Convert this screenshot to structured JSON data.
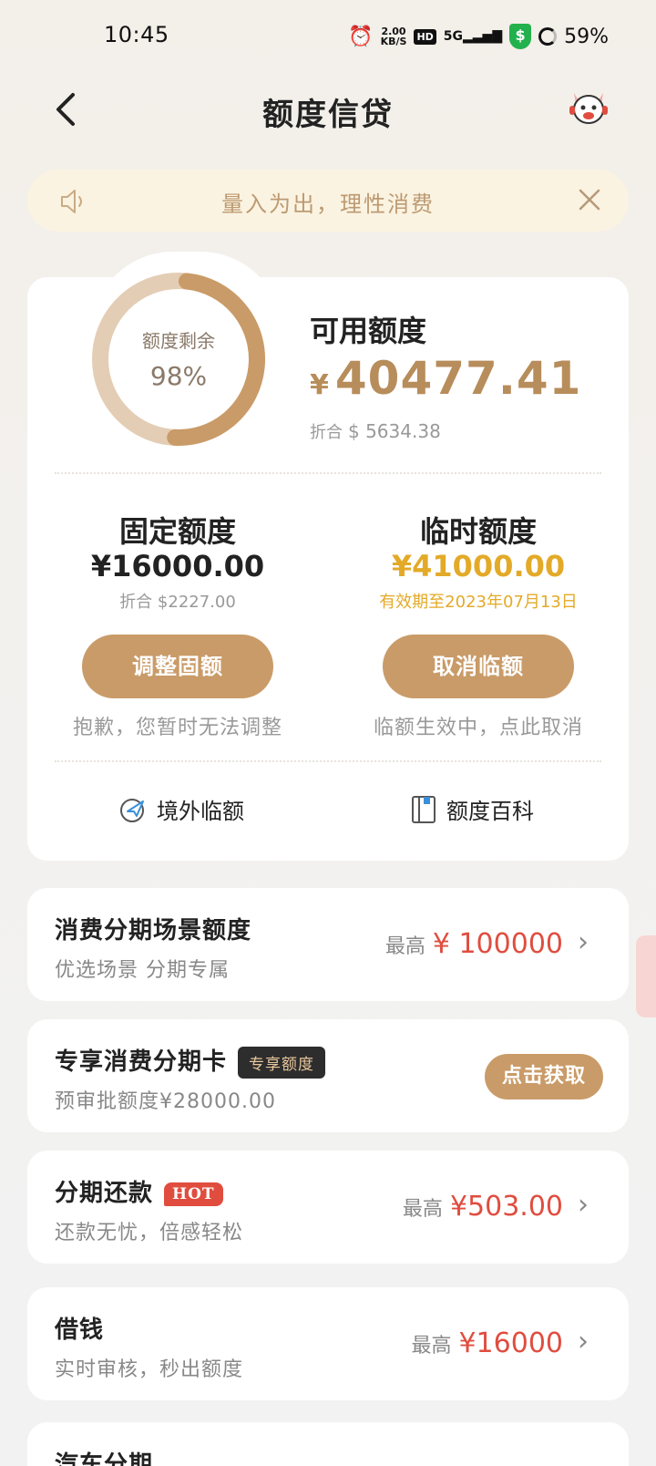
{
  "status": {
    "time": "10:45",
    "net_speed": "2.00",
    "net_unit": "KB/S",
    "hd": "HD",
    "signal": "5G",
    "battery": "59%"
  },
  "nav": {
    "title": "额度信贷",
    "back_icon": "chevron-left-icon",
    "service_icon": "mascot-icon"
  },
  "notice": {
    "text": "量入为出，理性消费"
  },
  "credit": {
    "remaining_label": "额度剩余",
    "remaining_percent": "98%",
    "remaining_fraction": 0.98,
    "available_title": "可用额度",
    "currency_symbol": "¥",
    "available_amount": "40477.41",
    "usd_label": "折合",
    "usd_amount": "$ 5634.38",
    "fixed": {
      "title": "固定额度",
      "amount": "¥16000.00",
      "sub": "折合 $2227.00",
      "button": "调整固额",
      "note": "抱歉，您暂时无法调整"
    },
    "temp": {
      "title": "临时额度",
      "amount": "¥41000.00",
      "sub": "有效期至2023年07月13日",
      "button": "取消临额",
      "note": "临额生效中，点此取消"
    },
    "links": {
      "overseas": "境外临额",
      "wiki": "额度百科"
    }
  },
  "rows": [
    {
      "title": "消费分期场景额度",
      "sub": "优选场景 分期专属",
      "max_label": "最高",
      "value": "¥ 100000"
    },
    {
      "title": "专享消费分期卡",
      "tag": "专享额度",
      "sub": "预审批额度¥28000.00",
      "button": "点击获取"
    },
    {
      "title": "分期还款",
      "tag": "HOT",
      "sub": "还款无忧，倍感轻松",
      "max_label": "最高",
      "value": "¥503.00"
    },
    {
      "title": "借钱",
      "sub": "实时审核，秒出额度",
      "max_label": "最高",
      "value": "¥16000"
    },
    {
      "title": "汽车分期"
    }
  ],
  "colors": {
    "gold": "#c99b68",
    "amount_gold": "#b78d5b",
    "temp_gold": "#e3aa28",
    "red": "#e04d3f",
    "notice_bg": "#fbf3e1"
  }
}
